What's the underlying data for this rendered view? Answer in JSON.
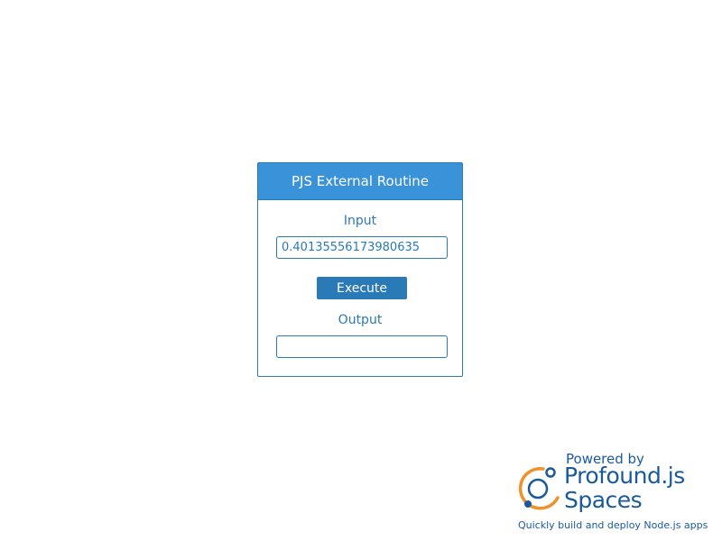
{
  "panel": {
    "title": "PJS External Routine",
    "input_label": "Input",
    "input_value": "0.40135556173980635",
    "execute_label": "Execute",
    "output_label": "Output",
    "output_value": ""
  },
  "branding": {
    "powered_by": "Powered by",
    "product_line1": "Profound.js",
    "product_line2": "Spaces",
    "tagline": "Quickly build and deploy Node.js apps",
    "logo_icon": "profound-orbit-logo-icon"
  },
  "colors": {
    "accent": "#2a7ab8",
    "header": "#3a92d8",
    "brand_blue": "#1a5a9c",
    "brand_orange": "#f0922b"
  }
}
